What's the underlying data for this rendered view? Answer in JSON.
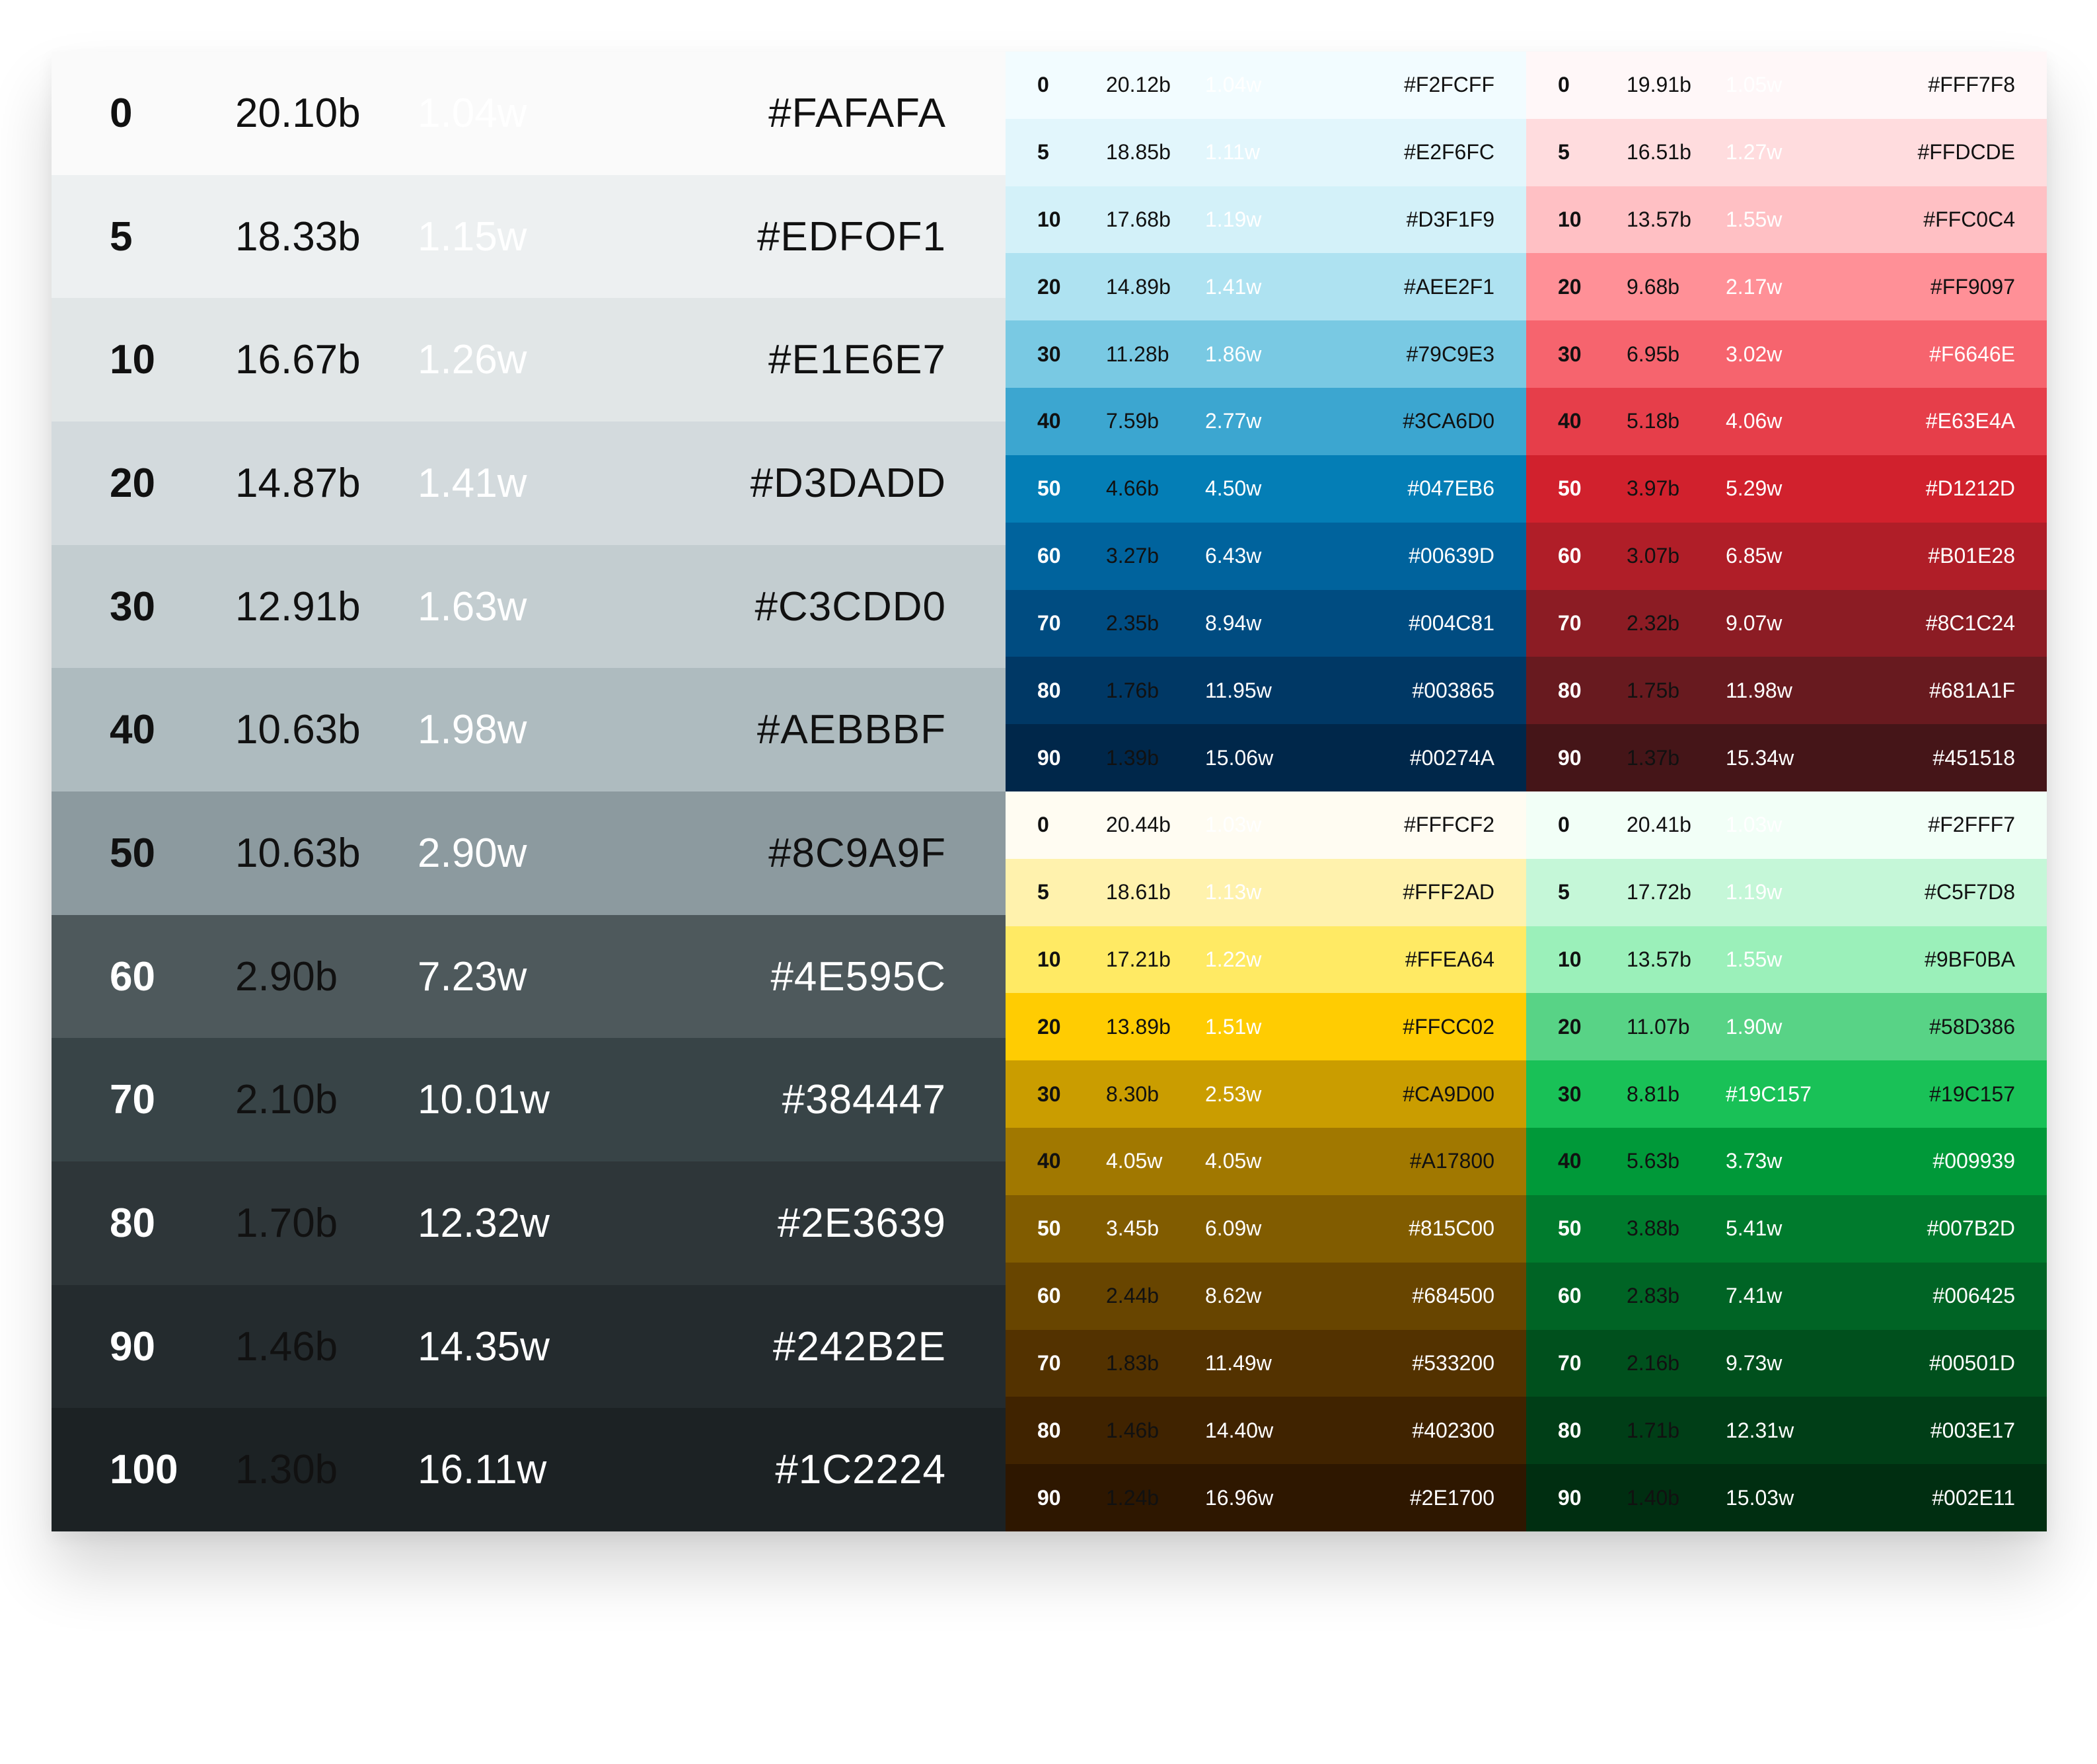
{
  "neutral": [
    {
      "step": "0",
      "b": "20.10b",
      "w": "1.04w",
      "hex": "#FAFAFA",
      "bg": "#FAFAFA",
      "cs": "#111111",
      "cb": "#111111",
      "cw": "#FFFFFF",
      "ch": "#111111"
    },
    {
      "step": "5",
      "b": "18.33b",
      "w": "1.15w",
      "hex": "#EDFOF1",
      "bg": "#EDF0F1",
      "cs": "#111111",
      "cb": "#111111",
      "cw": "#FFFFFF",
      "ch": "#111111"
    },
    {
      "step": "10",
      "b": "16.67b",
      "w": "1.26w",
      "hex": "#E1E6E7",
      "bg": "#E1E6E7",
      "cs": "#111111",
      "cb": "#111111",
      "cw": "#FFFFFF",
      "ch": "#111111"
    },
    {
      "step": "20",
      "b": "14.87b",
      "w": "1.41w",
      "hex": "#D3DADD",
      "bg": "#D3DADD",
      "cs": "#111111",
      "cb": "#111111",
      "cw": "#FFFFFF",
      "ch": "#111111"
    },
    {
      "step": "30",
      "b": "12.91b",
      "w": "1.63w",
      "hex": "#C3CDD0",
      "bg": "#C3CDD0",
      "cs": "#111111",
      "cb": "#111111",
      "cw": "#FFFFFF",
      "ch": "#111111"
    },
    {
      "step": "40",
      "b": "10.63b",
      "w": "1.98w",
      "hex": "#AEBBBF",
      "bg": "#AEBBBF",
      "cs": "#111111",
      "cb": "#111111",
      "cw": "#FFFFFF",
      "ch": "#111111"
    },
    {
      "step": "50",
      "b": "10.63b",
      "w": "2.90w",
      "hex": "#8C9A9F",
      "bg": "#8C9A9F",
      "cs": "#111111",
      "cb": "#111111",
      "cw": "#FFFFFF",
      "ch": "#111111"
    },
    {
      "step": "60",
      "b": "2.90b",
      "w": "7.23w",
      "hex": "#4E595C",
      "bg": "#4E595C",
      "cs": "#FFFFFF",
      "cb": "#111111",
      "cw": "#FFFFFF",
      "ch": "#FFFFFF"
    },
    {
      "step": "70",
      "b": "2.10b",
      "w": "10.01w",
      "hex": "#384447",
      "bg": "#384447",
      "cs": "#FFFFFF",
      "cb": "#111111",
      "cw": "#FFFFFF",
      "ch": "#FFFFFF"
    },
    {
      "step": "80",
      "b": "1.70b",
      "w": "12.32w",
      "hex": "#2E3639",
      "bg": "#2E3639",
      "cs": "#FFFFFF",
      "cb": "#111111",
      "cw": "#FFFFFF",
      "ch": "#FFFFFF"
    },
    {
      "step": "90",
      "b": "1.46b",
      "w": "14.35w",
      "hex": "#242B2E",
      "bg": "#242B2E",
      "cs": "#FFFFFF",
      "cb": "#111111",
      "cw": "#FFFFFF",
      "ch": "#FFFFFF"
    },
    {
      "step": "100",
      "b": "1.30b",
      "w": "16.11w",
      "hex": "#1C2224",
      "bg": "#1C2224",
      "cs": "#FFFFFF",
      "cb": "#111111",
      "cw": "#FFFFFF",
      "ch": "#FFFFFF"
    }
  ],
  "ramps": [
    {
      "name": "blue",
      "rows": [
        {
          "step": "0",
          "b": "20.12b",
          "w": "1.04w",
          "hex": "#F2FCFF",
          "bg": "#F2FCFF",
          "cs": "#111111",
          "cb": "#111111",
          "cw": "#FFFFFF",
          "ch": "#111111"
        },
        {
          "step": "5",
          "b": "18.85b",
          "w": "1.11w",
          "hex": "#E2F6FC",
          "bg": "#E2F6FC",
          "cs": "#111111",
          "cb": "#111111",
          "cw": "#FFFFFF",
          "ch": "#111111"
        },
        {
          "step": "10",
          "b": "17.68b",
          "w": "1.19w",
          "hex": "#D3F1F9",
          "bg": "#D3F1F9",
          "cs": "#111111",
          "cb": "#111111",
          "cw": "#FFFFFF",
          "ch": "#111111"
        },
        {
          "step": "20",
          "b": "14.89b",
          "w": "1.41w",
          "hex": "#AEE2F1",
          "bg": "#AEE2F1",
          "cs": "#111111",
          "cb": "#111111",
          "cw": "#FFFFFF",
          "ch": "#111111"
        },
        {
          "step": "30",
          "b": "11.28b",
          "w": "1.86w",
          "hex": "#79C9E3",
          "bg": "#79C9E3",
          "cs": "#111111",
          "cb": "#111111",
          "cw": "#FFFFFF",
          "ch": "#111111"
        },
        {
          "step": "40",
          "b": "7.59b",
          "w": "2.77w",
          "hex": "#3CA6D0",
          "bg": "#3CA6D0",
          "cs": "#111111",
          "cb": "#111111",
          "cw": "#FFFFFF",
          "ch": "#111111"
        },
        {
          "step": "50",
          "b": "4.66b",
          "w": "4.50w",
          "hex": "#047EB6",
          "bg": "#047EB6",
          "cs": "#FFFFFF",
          "cb": "#111111",
          "cw": "#FFFFFF",
          "ch": "#FFFFFF"
        },
        {
          "step": "60",
          "b": "3.27b",
          "w": "6.43w",
          "hex": "#00639D",
          "bg": "#00639D",
          "cs": "#FFFFFF",
          "cb": "#111111",
          "cw": "#FFFFFF",
          "ch": "#FFFFFF"
        },
        {
          "step": "70",
          "b": "2.35b",
          "w": "8.94w",
          "hex": "#004C81",
          "bg": "#004C81",
          "cs": "#FFFFFF",
          "cb": "#111111",
          "cw": "#FFFFFF",
          "ch": "#FFFFFF"
        },
        {
          "step": "80",
          "b": "1.76b",
          "w": "11.95w",
          "hex": "#003865",
          "bg": "#003865",
          "cs": "#FFFFFF",
          "cb": "#111111",
          "cw": "#FFFFFF",
          "ch": "#FFFFFF"
        },
        {
          "step": "90",
          "b": "1.39b",
          "w": "15.06w",
          "hex": "#00274A",
          "bg": "#00274A",
          "cs": "#FFFFFF",
          "cb": "#111111",
          "cw": "#FFFFFF",
          "ch": "#FFFFFF"
        }
      ]
    },
    {
      "name": "red",
      "rows": [
        {
          "step": "0",
          "b": "19.91b",
          "w": "1.05w",
          "hex": "#FFF7F8",
          "bg": "#FFF7F8",
          "cs": "#111111",
          "cb": "#111111",
          "cw": "#FFFFFF",
          "ch": "#111111"
        },
        {
          "step": "5",
          "b": "16.51b",
          "w": "1.27w",
          "hex": "#FFDCDE",
          "bg": "#FFDCDE",
          "cs": "#111111",
          "cb": "#111111",
          "cw": "#FFFFFF",
          "ch": "#111111"
        },
        {
          "step": "10",
          "b": "13.57b",
          "w": "1.55w",
          "hex": "#FFC0C4",
          "bg": "#FFC0C4",
          "cs": "#111111",
          "cb": "#111111",
          "cw": "#FFFFFF",
          "ch": "#111111"
        },
        {
          "step": "20",
          "b": "9.68b",
          "w": "2.17w",
          "hex": "#FF9097",
          "bg": "#FF9097",
          "cs": "#111111",
          "cb": "#111111",
          "cw": "#FFFFFF",
          "ch": "#111111"
        },
        {
          "step": "30",
          "b": "6.95b",
          "w": "3.02w",
          "hex": "#F6646E",
          "bg": "#F6646E",
          "cs": "#111111",
          "cb": "#111111",
          "cw": "#FFFFFF",
          "ch": "#FFFFFF"
        },
        {
          "step": "40",
          "b": "5.18b",
          "w": "4.06w",
          "hex": "#E63E4A",
          "bg": "#E63E4A",
          "cs": "#111111",
          "cb": "#111111",
          "cw": "#FFFFFF",
          "ch": "#FFFFFF"
        },
        {
          "step": "50",
          "b": "3.97b",
          "w": "5.29w",
          "hex": "#D1212D",
          "bg": "#D1212D",
          "cs": "#FFFFFF",
          "cb": "#111111",
          "cw": "#FFFFFF",
          "ch": "#FFFFFF"
        },
        {
          "step": "60",
          "b": "3.07b",
          "w": "6.85w",
          "hex": "#B01E28",
          "bg": "#B01E28",
          "cs": "#FFFFFF",
          "cb": "#111111",
          "cw": "#FFFFFF",
          "ch": "#FFFFFF"
        },
        {
          "step": "70",
          "b": "2.32b",
          "w": "9.07w",
          "hex": "#8C1C24",
          "bg": "#8C1C24",
          "cs": "#FFFFFF",
          "cb": "#111111",
          "cw": "#FFFFFF",
          "ch": "#FFFFFF"
        },
        {
          "step": "80",
          "b": "1.75b",
          "w": "11.98w",
          "hex": "#681A1F",
          "bg": "#681A1F",
          "cs": "#FFFFFF",
          "cb": "#111111",
          "cw": "#FFFFFF",
          "ch": "#FFFFFF"
        },
        {
          "step": "90",
          "b": "1.37b",
          "w": "15.34w",
          "hex": "#451518",
          "bg": "#451518",
          "cs": "#FFFFFF",
          "cb": "#111111",
          "cw": "#FFFFFF",
          "ch": "#FFFFFF"
        }
      ]
    },
    {
      "name": "yellow",
      "rows": [
        {
          "step": "0",
          "b": "20.44b",
          "w": "1.03w",
          "hex": "#FFFCF2",
          "bg": "#FFFCF2",
          "cs": "#111111",
          "cb": "#111111",
          "cw": "#FFFFFF",
          "ch": "#111111"
        },
        {
          "step": "5",
          "b": "18.61b",
          "w": "1.13w",
          "hex": "#FFF2AD",
          "bg": "#FFF2AD",
          "cs": "#111111",
          "cb": "#111111",
          "cw": "#FFFFFF",
          "ch": "#111111"
        },
        {
          "step": "10",
          "b": "17.21b",
          "w": "1.22w",
          "hex": "#FFEA64",
          "bg": "#FFEA64",
          "cs": "#111111",
          "cb": "#111111",
          "cw": "#FFFFFF",
          "ch": "#111111"
        },
        {
          "step": "20",
          "b": "13.89b",
          "w": "1.51w",
          "hex": "#FFCC02",
          "bg": "#FFCC02",
          "cs": "#111111",
          "cb": "#111111",
          "cw": "#FFFFFF",
          "ch": "#111111"
        },
        {
          "step": "30",
          "b": "8.30b",
          "w": "2.53w",
          "hex": "#CA9D00",
          "bg": "#CA9D00",
          "cs": "#111111",
          "cb": "#111111",
          "cw": "#FFFFFF",
          "ch": "#111111"
        },
        {
          "step": "40",
          "b": "4.05w",
          "w": "4.05w",
          "hex": "#A17800",
          "bg": "#A17800",
          "cs": "#111111",
          "cb": "#FFFFFF",
          "cw": "#FFFFFF",
          "ch": "#111111"
        },
        {
          "step": "50",
          "b": "3.45b",
          "w": "6.09w",
          "hex": "#815C00",
          "bg": "#815C00",
          "cs": "#FFFFFF",
          "cb": "#FFFFFF",
          "cw": "#FFFFFF",
          "ch": "#FFFFFF"
        },
        {
          "step": "60",
          "b": "2.44b",
          "w": "8.62w",
          "hex": "#684500",
          "bg": "#684500",
          "cs": "#FFFFFF",
          "cb": "#111111",
          "cw": "#FFFFFF",
          "ch": "#FFFFFF"
        },
        {
          "step": "70",
          "b": "1.83b",
          "w": "11.49w",
          "hex": "#533200",
          "bg": "#533200",
          "cs": "#FFFFFF",
          "cb": "#111111",
          "cw": "#FFFFFF",
          "ch": "#FFFFFF"
        },
        {
          "step": "80",
          "b": "1.46b",
          "w": "14.40w",
          "hex": "#402300",
          "bg": "#402300",
          "cs": "#FFFFFF",
          "cb": "#111111",
          "cw": "#FFFFFF",
          "ch": "#FFFFFF"
        },
        {
          "step": "90",
          "b": "1.24b",
          "w": "16.96w",
          "hex": "#2E1700",
          "bg": "#2E1700",
          "cs": "#FFFFFF",
          "cb": "#111111",
          "cw": "#FFFFFF",
          "ch": "#FFFFFF"
        }
      ]
    },
    {
      "name": "green",
      "rows": [
        {
          "step": "0",
          "b": "20.41b",
          "w": "1.03w",
          "hex": "#F2FFF7",
          "bg": "#F2FFF7",
          "cs": "#111111",
          "cb": "#111111",
          "cw": "#FFFFFF",
          "ch": "#111111"
        },
        {
          "step": "5",
          "b": "17.72b",
          "w": "1.19w",
          "hex": "#C5F7D8",
          "bg": "#C5F7D8",
          "cs": "#111111",
          "cb": "#111111",
          "cw": "#FFFFFF",
          "ch": "#111111"
        },
        {
          "step": "10",
          "b": "13.57b",
          "w": "1.55w",
          "hex": "#9BF0BA",
          "bg": "#9BF0BA",
          "cs": "#111111",
          "cb": "#111111",
          "cw": "#FFFFFF",
          "ch": "#111111"
        },
        {
          "step": "20",
          "b": "11.07b",
          "w": "1.90w",
          "hex": "#58D386",
          "bg": "#58D386",
          "cs": "#111111",
          "cb": "#111111",
          "cw": "#FFFFFF",
          "ch": "#111111"
        },
        {
          "step": "30",
          "b": "8.81b",
          "w": "#19C157",
          "hex": "#19C157",
          "bg": "#19C157",
          "cs": "#111111",
          "cb": "#111111",
          "cw": "#FFFFFF",
          "ch": "#111111"
        },
        {
          "step": "40",
          "b": "5.63b",
          "w": "3.73w",
          "hex": "#009939",
          "bg": "#009939",
          "cs": "#111111",
          "cb": "#111111",
          "cw": "#FFFFFF",
          "ch": "#FFFFFF"
        },
        {
          "step": "50",
          "b": "3.88b",
          "w": "5.41w",
          "hex": "#007B2D",
          "bg": "#007B2D",
          "cs": "#FFFFFF",
          "cb": "#111111",
          "cw": "#FFFFFF",
          "ch": "#FFFFFF"
        },
        {
          "step": "60",
          "b": "2.83b",
          "w": "7.41w",
          "hex": "#006425",
          "bg": "#006425",
          "cs": "#FFFFFF",
          "cb": "#111111",
          "cw": "#FFFFFF",
          "ch": "#FFFFFF"
        },
        {
          "step": "70",
          "b": "2.16b",
          "w": "9.73w",
          "hex": "#00501D",
          "bg": "#00501D",
          "cs": "#FFFFFF",
          "cb": "#111111",
          "cw": "#FFFFFF",
          "ch": "#FFFFFF"
        },
        {
          "step": "80",
          "b": "1.71b",
          "w": "12.31w",
          "hex": "#003E17",
          "bg": "#003E17",
          "cs": "#FFFFFF",
          "cb": "#111111",
          "cw": "#FFFFFF",
          "ch": "#FFFFFF"
        },
        {
          "step": "90",
          "b": "1.40b",
          "w": "15.03w",
          "hex": "#002E11",
          "bg": "#002E11",
          "cs": "#FFFFFF",
          "cb": "#111111",
          "cw": "#FFFFFF",
          "ch": "#FFFFFF"
        }
      ]
    }
  ]
}
